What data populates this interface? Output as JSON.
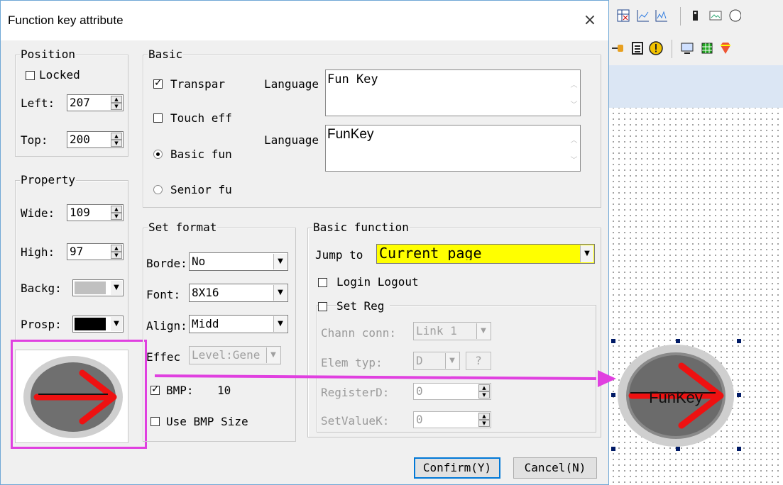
{
  "dialog": {
    "title": "Function key attribute",
    "close_glyph": "×"
  },
  "position": {
    "label": "Position",
    "locked_label": "Locked",
    "locked": false,
    "left_label": "Left:",
    "left_value": "207",
    "top_label": "Top:",
    "top_value": "200"
  },
  "property": {
    "label": "Property",
    "wide_label": "Wide:",
    "wide_value": "109",
    "high_label": "High:",
    "high_value": "97",
    "backg_label": "Backg:",
    "backg_color": "#c0c0c0",
    "prosp_label": "Prosp:",
    "prosp_color": "#000000"
  },
  "basic": {
    "label": "Basic",
    "transparent_label": "Transpar",
    "transparent": true,
    "touch_label": "Touch eff",
    "touch": false,
    "basic_fun_label": "Basic fun",
    "senior_fu_label": "Senior fu",
    "selected_mode": "basic",
    "language1_label": "Language",
    "language1_value": "Fun Key",
    "language2_label": "Language",
    "language2_value": "FunKey"
  },
  "set_format": {
    "label": "Set format",
    "border_label": "Borde:",
    "border_value": "No",
    "font_label": "Font:",
    "font_value": "8X16",
    "align_label": "Align:",
    "align_value": "Midd",
    "effect_label": "Effec",
    "effect_value": "Level:Gene",
    "bmp_label": "BMP:",
    "bmp_checked": true,
    "bmp_value": "10",
    "use_bmp_size_label": "Use BMP Size",
    "use_bmp_size": false
  },
  "basic_function": {
    "label": "Basic function",
    "jump_to_label": "Jump to",
    "jump_to_value": "Current page",
    "jump_to_highlight": "#ffff00",
    "login_logout_label": "Login Logout",
    "login_logout": false,
    "set_reg_label": "Set Reg",
    "set_reg": false,
    "chann_conn_label": "Chann conn:",
    "chann_conn_value": "Link 1",
    "elem_typ_label": "Elem typ:",
    "elem_typ_value": "D",
    "elem_help": "?",
    "register_label": "RegisterD:",
    "register_value": "0",
    "set_value_label": "SetValueK:",
    "set_value_value": "0"
  },
  "buttons": {
    "confirm": "Confirm(Y)",
    "cancel": "Cancel(N)"
  },
  "preview": {
    "canvas_button_text": "FunKey"
  },
  "colors": {
    "annotation": "#e040e0",
    "arrow_red": "#ee1111",
    "dialog_border": "#6fa7d6"
  }
}
